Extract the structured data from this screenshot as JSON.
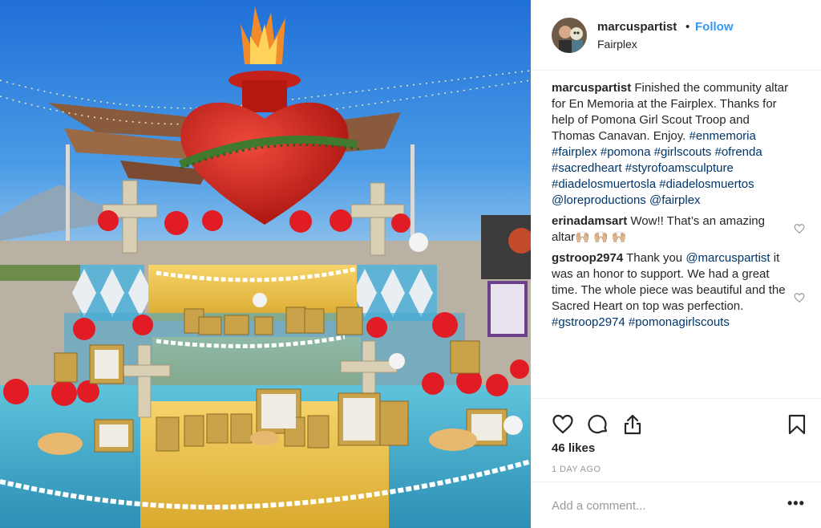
{
  "post": {
    "username": "marcuspartist",
    "dot": "•",
    "follow_label": "Follow",
    "location": "Fairplex",
    "avatar_icon": "user-avatar"
  },
  "caption": {
    "user": "marcuspartist",
    "text": "Finished the community altar for En Memoria at the Fairplex. Thanks for help of Pomona Girl Scout Troop and Thomas Canavan. Enjoy.",
    "tags": [
      "#enmemoria",
      "#fairplex",
      "#pomona",
      "#girlscouts",
      "#ofrenda",
      "#sacredheart",
      "#styrofoamsculpture",
      "#diadelosmuertosla",
      "#diadelosmuertos",
      "@loreproductions",
      "@fairplex"
    ]
  },
  "comments": [
    {
      "user": "erinadamsart",
      "text": "Wow!! That’s an amazing altar",
      "emoji": "🙌🏼 🙌🏼 🙌🏼"
    },
    {
      "user": "gstroop2974",
      "text_pre": "Thank you",
      "mention": "@marcuspartist",
      "text_post": "it was an honor to support. We had a great time. The whole piece was beautiful and the Sacred Heart on top was perfection.",
      "tags": [
        "#gstroop2974",
        "#pomonagirlscouts"
      ]
    }
  ],
  "actions": {
    "like_icon": "heart-icon",
    "comment_icon": "comment-icon",
    "share_icon": "share-icon",
    "save_icon": "bookmark-icon",
    "likes": "46 likes",
    "time_ago": "1 DAY AGO"
  },
  "add_comment": {
    "placeholder": "Add a comment...",
    "more_label": "•••"
  },
  "colors": {
    "link": "#003569",
    "follow": "#3897f0",
    "muted": "#999999"
  }
}
